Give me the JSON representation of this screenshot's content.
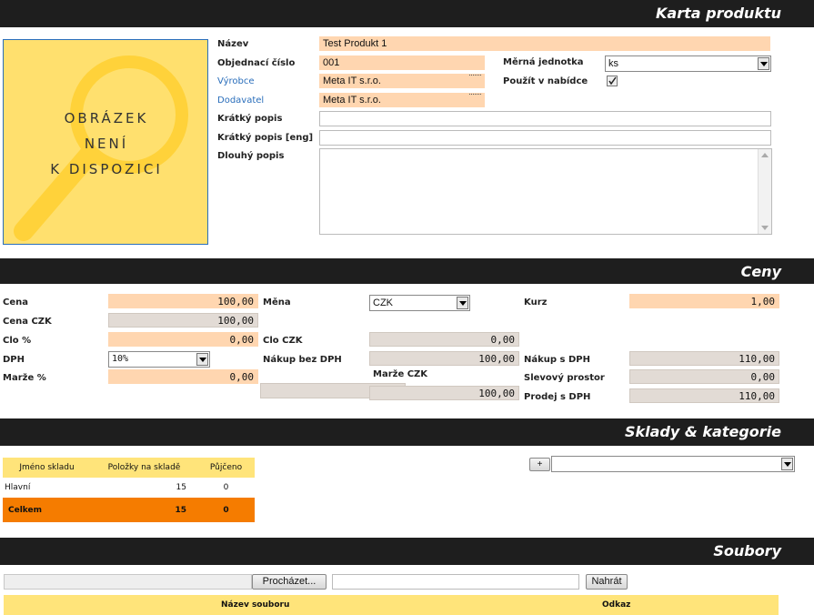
{
  "sections": {
    "product": "Karta produktu",
    "prices": "Ceny",
    "stock": "Sklady & kategorie",
    "files": "Soubory"
  },
  "image_placeholder": {
    "line1": "OBRÁZEK",
    "line2": "NENÍ",
    "line3": "K DISPOZICI"
  },
  "product": {
    "name_label": "Název",
    "name_value": "Test Produkt 1",
    "order_label": "Objednací číslo",
    "order_value": "001",
    "unit_label": "Měrná jednotka",
    "unit_value": "ks",
    "manufacturer_label": "Výrobce",
    "manufacturer_value": "Meta IT s.r.o.",
    "offer_label": "Použít v nabídce",
    "offer_checked": true,
    "supplier_label": "Dodavatel",
    "supplier_value": "Meta IT s.r.o.",
    "short_desc_label": "Krátký popis",
    "short_desc_value": "",
    "short_desc_eng_label": "Krátký popis [eng]",
    "short_desc_eng_value": "",
    "long_desc_label": "Dlouhý popis",
    "long_desc_value": ""
  },
  "prices": {
    "price_label": "Cena",
    "price_value": "100,00",
    "currency_label": "Měna",
    "currency_value": "CZK",
    "rate_label": "Kurz",
    "rate_value": "1,00",
    "price_czk_label": "Cena CZK",
    "price_czk_value": "100,00",
    "duty_pct_label": "Clo %",
    "duty_pct_value": "0,00",
    "duty_czk_label": "Clo CZK",
    "duty_czk_value": "0,00",
    "vat_label": "DPH",
    "vat_value": "10%",
    "buy_no_vat_label": "Nákup bez DPH",
    "buy_no_vat_value": "100,00",
    "buy_vat_label": "Nákup s DPH",
    "buy_vat_value": "110,00",
    "margin_pct_label": "Marže %",
    "margin_pct_value": "0,00",
    "margin_czk_label": "Marže CZK",
    "margin_czk_value": "100,00",
    "discount_label": "Slevový prostor",
    "discount_value": "0,00",
    "sell_vat_label": "Prodej s DPH",
    "sell_vat_value": "110,00"
  },
  "stock": {
    "headers": [
      "Jméno skladu",
      "Položky na skladě",
      "Půjčeno"
    ],
    "rows": [
      [
        "Hlavní",
        "15",
        "0"
      ]
    ],
    "total": [
      "Celkem",
      "15",
      "0"
    ],
    "add_button": "+",
    "category_value": ""
  },
  "files": {
    "browse_button": "Procházet...",
    "upload_button": "Nahrát",
    "headers": [
      "Název souboru",
      "Odkaz"
    ]
  },
  "colors": {
    "header_bg": "#1e1e1e",
    "editable": "#ffd6b0",
    "readonly": "#e2dbd5",
    "table_head": "#ffe47a",
    "total_row": "#f57c00"
  }
}
